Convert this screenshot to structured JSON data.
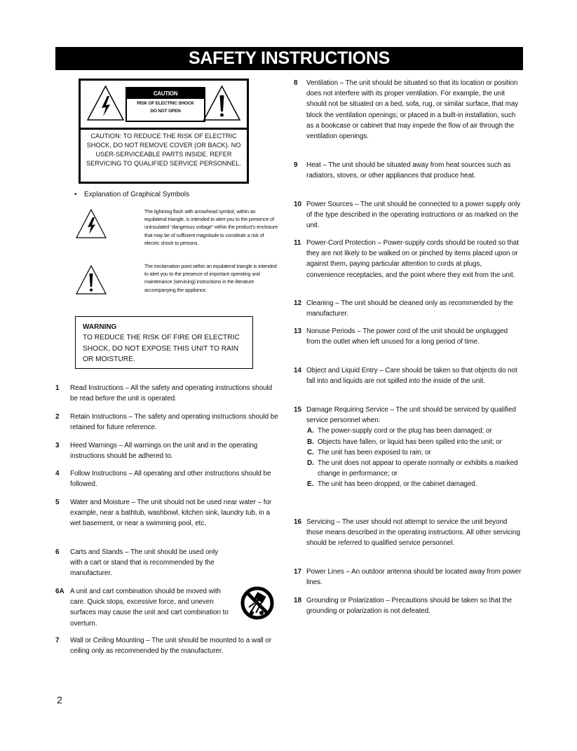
{
  "page_title": "SAFETY INSTRUCTIONS",
  "caution_label": {
    "heading": "CAUTION",
    "sub_line_1": "RISK OF ELECTRIC SHOCK",
    "sub_line_2": "DO NOT OPEN",
    "text": "CAUTION:  TO REDUCE THE RISK OF ELECTRIC SHOCK, DO NOT REMOVE COVER (OR BACK). NO USER-SERVICEABLE PARTS INSIDE. REFER SERVICING TO QUALIFIED SERVICE PERSONNEL.",
    "left_icon": "lightning-triangle-icon",
    "right_icon": "exclamation-triangle-icon"
  },
  "symbols": {
    "bullet": "•",
    "heading": "Explanation of Graphical Symbols",
    "lightning_text": "The lightning flash with arrowhead symbol, within an equilateral triangle, is intended to alert you to the presence of uninsulated “dangerous voltage” within the product’s enclosure that may be of sufficient magnitude to constitute a risk of electric shock to persons.",
    "exclamation_text": "The exclamation point within an equilateral triangle is intended to alert you to the presence of important operating and maintenance (servicing) instructions in the literature accompanying the appliance."
  },
  "warning": {
    "title": "WARNING",
    "text": "TO REDUCE THE RISK OF FIRE OR ELECTRIC SHOCK, DO NOT EXPOSE THIS UNIT TO RAIN OR MOISTURE."
  },
  "instructions": [
    {
      "num": "1",
      "text": "Read Instructions – All the safety and operating instructions should be read before the unit is operated."
    },
    {
      "num": "2",
      "text": "Retain Instructions – The safety and operating instructions should be retained for future reference."
    },
    {
      "num": "3",
      "text": "Heed Warnings – All warnings on the unit and in the operating instructions should be adhered to."
    },
    {
      "num": "4",
      "text": "Follow Instructions – All operating and other instructions should be followed."
    },
    {
      "num": "5",
      "text": "Water and Moisture – The unit should not be used near water – for example, near a bathtub, washbowl, kitchen sink, laundry tub, in a wet basement, or near a swimming pool, etc."
    },
    {
      "num": "6",
      "text": "Carts and Stands – The unit should be used only with a cart or stand that is recommended by the manufacturer."
    },
    {
      "num": "6A",
      "text": "A unit and cart combination should be moved with care.  Quick stops, excessive force, and uneven surfaces may cause the unit and cart combination to overturn."
    },
    {
      "num": "7",
      "text": "Wall or Ceiling Mounting – The unit should be mounted to a wall or ceiling only as recommended by the manufacturer."
    },
    {
      "num": "8",
      "text": "Ventilation – The unit should be situated so that its location or position does not interfere with its proper ventilation.  For example, the unit should not be situated on a bed, sofa, rug, or similar surface, that may block the ventilation openings; or placed in a built-in installation, such as a bookcase or cabinet that may impede the flow of air through the ventilation openings."
    },
    {
      "num": "9",
      "text": "Heat – The unit should be situated away from heat sources such as radiators, stoves, or other appliances that produce heat."
    },
    {
      "num": "10",
      "text": "Power Sources – The unit should be connected to a power supply only of the type described in the operating instructions or as marked on the unit."
    },
    {
      "num": "11",
      "text": "Power-Cord Protection – Power-supply cords should be routed so that they are not likely to be walked on or pinched by items placed upon or against them, paying particular attention to cords at plugs, convenience receptacles, and the point where they exit from the unit."
    },
    {
      "num": "12",
      "text": "Cleaning – The unit should be cleaned only as recommended by the manufacturer."
    },
    {
      "num": "13",
      "text": "Nonuse Periods – The power cord of the unit should be unplugged from the outlet when left unused for a long period of time."
    },
    {
      "num": "14",
      "text": "Object and Liquid Entry – Care should be taken so that objects do not fall into and liquids are not spilled into the inside of the unit."
    },
    {
      "num": "15",
      "text": "Damage Requiring Service – The unit should be serviced by qualified service personnel when:",
      "sub": [
        {
          "letter": "A.",
          "text": "The power-supply cord or the plug has been damaged; or"
        },
        {
          "letter": "B.",
          "text": "Objects have fallen, or liquid has been spilled into the unit; or"
        },
        {
          "letter": "C.",
          "text": "The unit has been exposed to rain; or"
        },
        {
          "letter": "D.",
          "text": "The unit does not appear to operate normally or exhibits a marked change in performance; or"
        },
        {
          "letter": "E.",
          "text": "The unit has been dropped, or the cabinet damaged."
        }
      ]
    },
    {
      "num": "16",
      "text": "Servicing – The user should not attempt to service the unit beyond those means described in the operating instructions.  All other servicing should be referred to qualified service personnel."
    },
    {
      "num": "17",
      "text": "Power Lines – An outdoor antenna should be located away from power lines."
    },
    {
      "num": "18",
      "text": "Grounding or Polarization – Precautions should be taken so that the grounding or polarization is not defeated."
    }
  ],
  "cart_icon": "cart-tip-over-warning-icon",
  "page_number": "2"
}
